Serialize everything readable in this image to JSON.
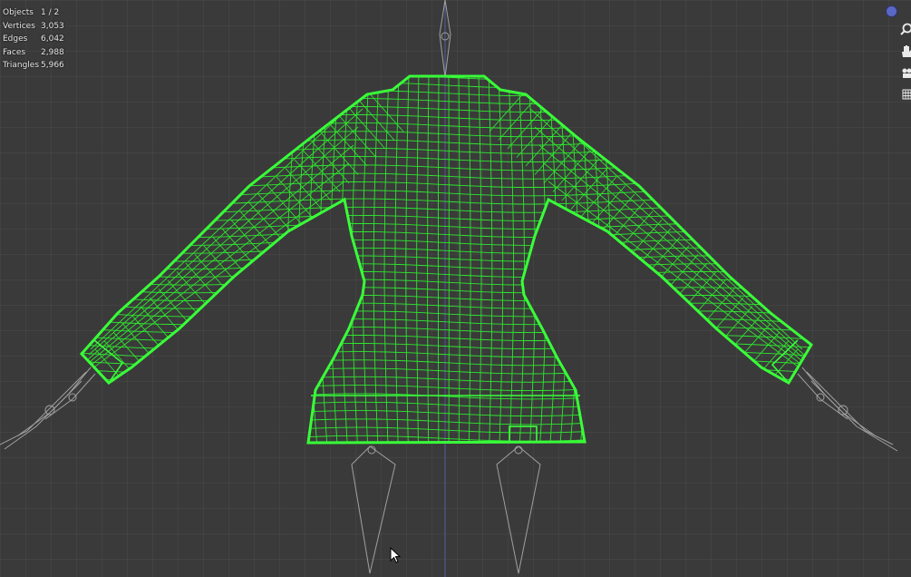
{
  "stats": {
    "rows": [
      {
        "label": "Objects",
        "value": "1 / 2"
      },
      {
        "label": "Vertices",
        "value": "3,053"
      },
      {
        "label": "Edges",
        "value": "6,042"
      },
      {
        "label": "Faces",
        "value": "2,988"
      },
      {
        "label": "Triangles",
        "value": "5,966"
      }
    ]
  },
  "navigation": {
    "zoom_icon": "magnifier-icon",
    "pan_icon": "hand-icon",
    "camera_icon": "camera-icon",
    "grid_icon": "grid-icon",
    "axis_color": "#5a67c4"
  },
  "colors": {
    "background": "#3a3a3a",
    "grid_line": "#444444",
    "selected_wire": "#2ee82e",
    "selected_outline": "#39ff39",
    "armature": "#9a9a9a",
    "z_axis": "#5a5fa8"
  }
}
